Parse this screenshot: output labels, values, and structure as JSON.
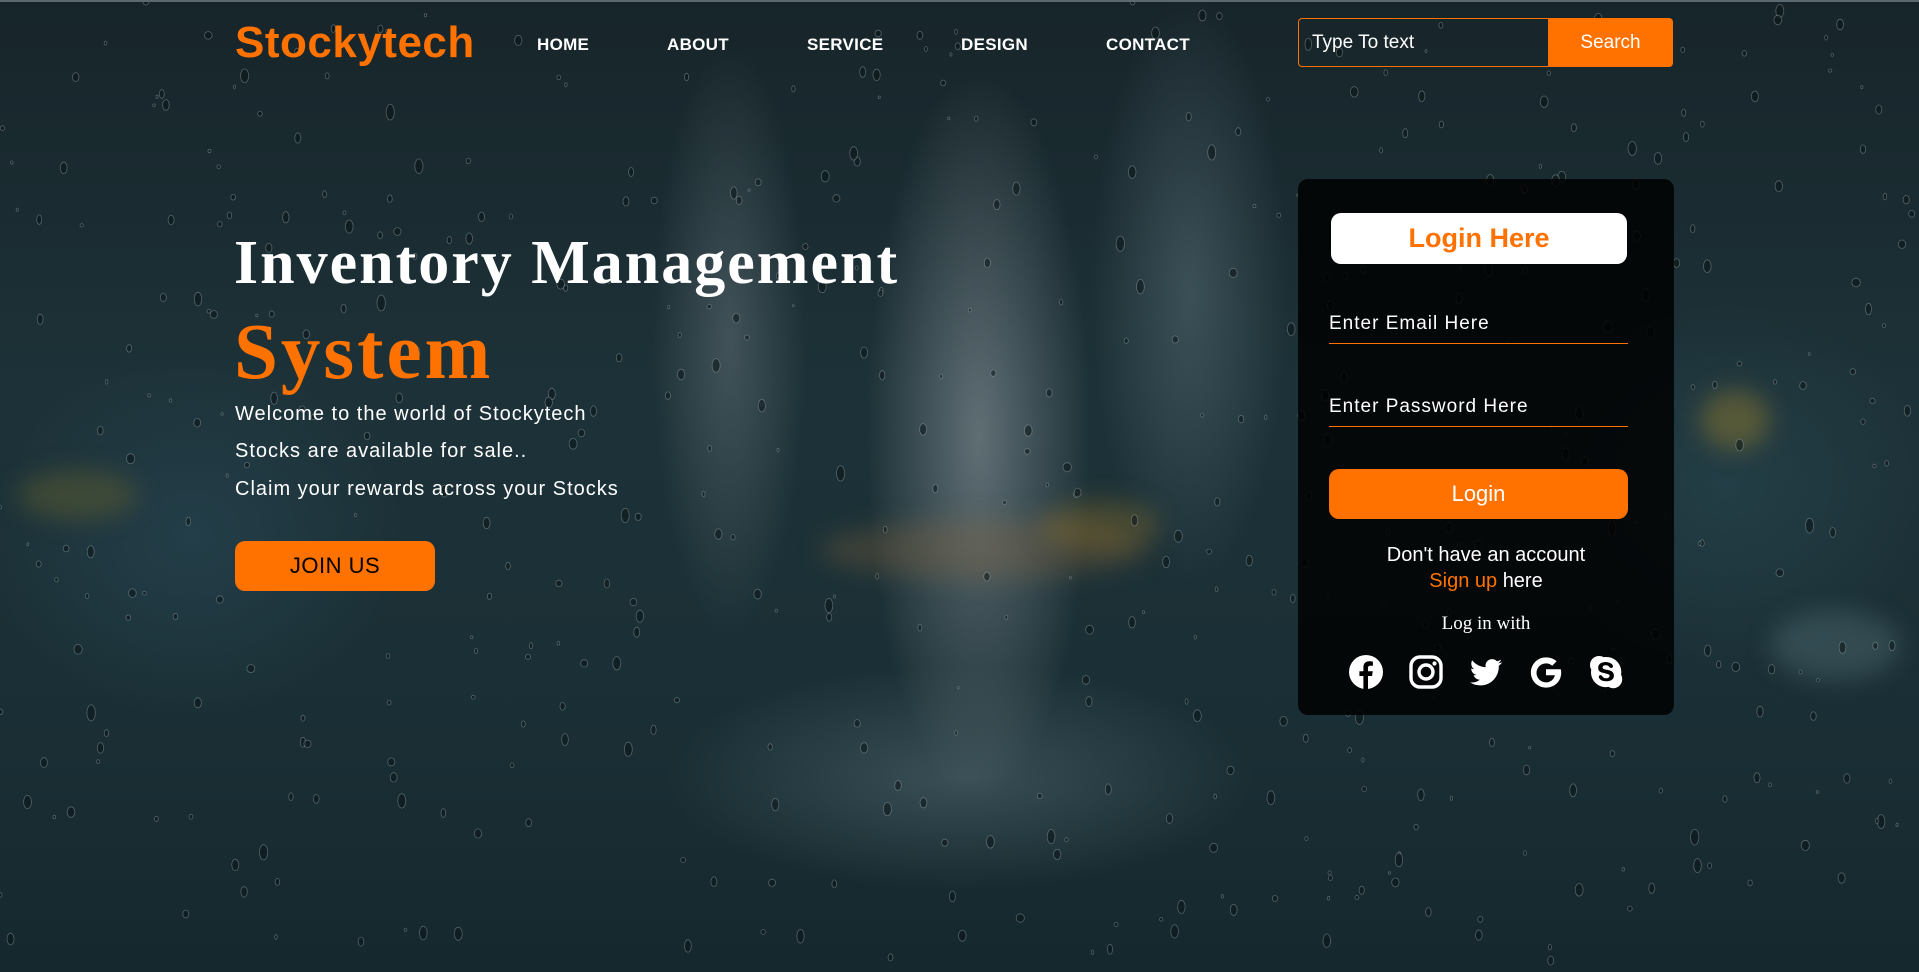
{
  "header": {
    "logo": "Stockytech",
    "nav": [
      {
        "label": "HOME",
        "key": "home"
      },
      {
        "label": "ABOUT",
        "key": "about"
      },
      {
        "label": "SERVICE",
        "key": "service"
      },
      {
        "label": "DESIGN",
        "key": "design"
      },
      {
        "label": "CONTACT",
        "key": "contact"
      }
    ],
    "search": {
      "placeholder": "Type To text",
      "value": "",
      "button_label": "Search"
    }
  },
  "hero": {
    "title": "Inventory Management",
    "subtitle": "System",
    "lines": [
      "Welcome to the world of Stockytech",
      "Stocks are available for sale..",
      "Claim your rewards across your Stocks"
    ],
    "join_label": "JOIN US"
  },
  "login": {
    "title": "Login Here",
    "email_placeholder": "Enter Email Here",
    "password_placeholder": "Enter Password Here",
    "button_label": "Login",
    "no_account": "Don't have an account",
    "signup_link": "Sign up",
    "signup_suffix": "here",
    "log_in_with": "Log in with",
    "socials": [
      "facebook-icon",
      "instagram-icon",
      "twitter-icon",
      "google-icon",
      "skype-icon"
    ]
  },
  "colors": {
    "accent": "#ff7200",
    "card_bg": "#000000",
    "text": "#ffffff"
  }
}
